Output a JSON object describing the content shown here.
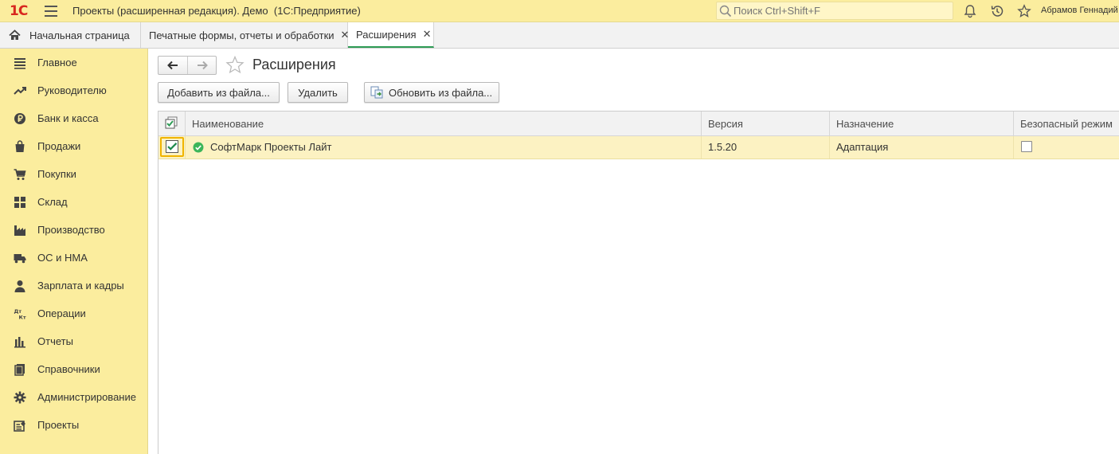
{
  "titlebar": {
    "logo": "1С",
    "title": "Проекты (расширенная редакция). Демо  (1С:Предприятие)",
    "search_placeholder": "Поиск Ctrl+Shift+F",
    "user": "Абрамов Геннадий"
  },
  "tabs": [
    {
      "label": "Начальная страница",
      "icon": "home-icon"
    },
    {
      "label": "Печатные формы, отчеты и обработки",
      "closable": true
    },
    {
      "label": "Расширения",
      "closable": true,
      "active": true
    }
  ],
  "sidebar": {
    "items": [
      {
        "label": "Главное",
        "icon": "list-icon"
      },
      {
        "label": "Руководителю",
        "icon": "trend-icon"
      },
      {
        "label": "Банк и касса",
        "icon": "ruble-icon"
      },
      {
        "label": "Продажи",
        "icon": "bag-icon"
      },
      {
        "label": "Покупки",
        "icon": "cart-icon"
      },
      {
        "label": "Склад",
        "icon": "warehouse-icon"
      },
      {
        "label": "Производство",
        "icon": "factory-icon"
      },
      {
        "label": "ОС и НМА",
        "icon": "truck-icon"
      },
      {
        "label": "Зарплата и кадры",
        "icon": "person-icon"
      },
      {
        "label": "Операции",
        "icon": "dt-kt-icon"
      },
      {
        "label": "Отчеты",
        "icon": "bar-chart-icon"
      },
      {
        "label": "Справочники",
        "icon": "books-icon"
      },
      {
        "label": "Администрирование",
        "icon": "gear-icon"
      },
      {
        "label": "Проекты",
        "icon": "projects-icon"
      }
    ]
  },
  "page": {
    "title": "Расширения",
    "buttons": {
      "add_from_file": "Добавить из файла...",
      "delete": "Удалить",
      "update_from_file": "Обновить из файла..."
    }
  },
  "table": {
    "columns": [
      "Наименование",
      "Версия",
      "Назначение",
      "Безопасный режим"
    ],
    "rows": [
      {
        "active": true,
        "name": "СофтМарк Проекты Лайт",
        "version": "1.5.20",
        "purpose": "Адаптация",
        "safe_mode": false
      }
    ]
  },
  "colors": {
    "accent_yellow": "#fbed9e",
    "active_tab_underline": "#2e9c55",
    "logo_red": "#d8281f",
    "selected_row": "#fcf2c2"
  }
}
